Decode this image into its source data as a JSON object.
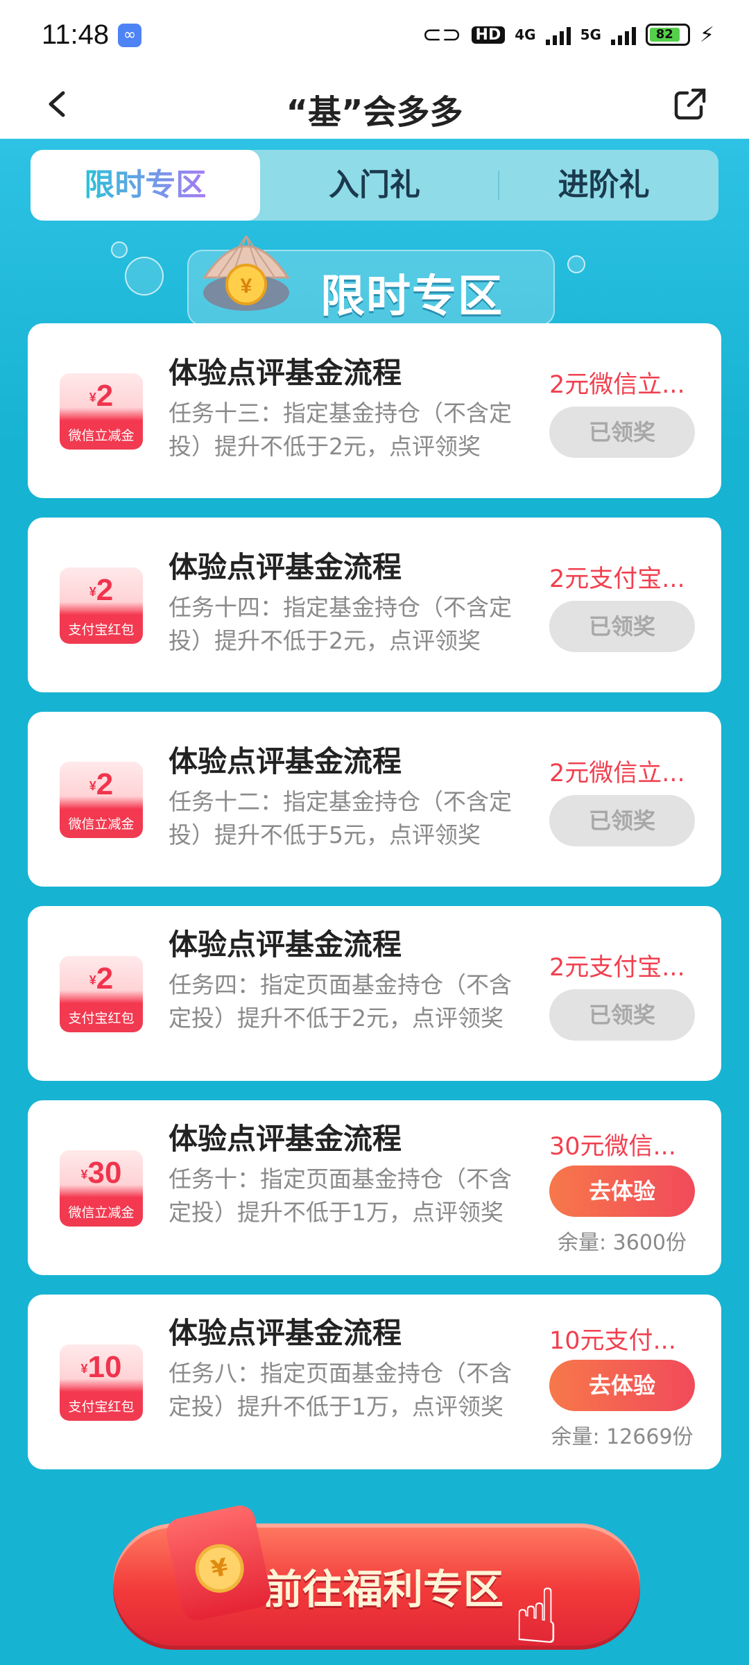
{
  "status_bar": {
    "time": "11:48",
    "network1": "4G",
    "network2": "5G",
    "hd_label": "HD",
    "battery": "82"
  },
  "nav": {
    "title": "“基”会多多"
  },
  "tabs": [
    {
      "label": "限时专区",
      "active": true
    },
    {
      "label": "入门礼",
      "active": false
    },
    {
      "label": "进阶礼",
      "active": false
    }
  ],
  "banner": {
    "title": "限时专区"
  },
  "tasks": [
    {
      "coupon_amount": "2",
      "coupon_label": "微信立减金",
      "title": "体验点评基金流程",
      "desc": "任务十三：指定基金持仓（不含定投）提升不低于2元，点评领奖",
      "reward": "2元微信立...",
      "button": "已领奖",
      "claimed": true
    },
    {
      "coupon_amount": "2",
      "coupon_label": "支付宝红包",
      "title": "体验点评基金流程",
      "desc": "任务十四：指定基金持仓（不含定投）提升不低于2元，点评领奖",
      "reward": "2元支付宝...",
      "button": "已领奖",
      "claimed": true
    },
    {
      "coupon_amount": "2",
      "coupon_label": "微信立减金",
      "title": "体验点评基金流程",
      "desc": "任务十二：指定基金持仓（不含定投）提升不低于5元，点评领奖",
      "reward": "2元微信立...",
      "button": "已领奖",
      "claimed": true
    },
    {
      "coupon_amount": "2",
      "coupon_label": "支付宝红包",
      "title": "体验点评基金流程",
      "desc": "任务四：指定页面基金持仓（不含定投）提升不低于2元，点评领奖",
      "reward": "2元支付宝...",
      "button": "已领奖",
      "claimed": true
    },
    {
      "coupon_amount": "30",
      "coupon_label": "微信立减金",
      "title": "体验点评基金流程",
      "desc": "任务十：指定页面基金持仓（不含定投）提升不低于1万，点评领奖",
      "reward": "30元微信...",
      "button": "去体验",
      "claimed": false,
      "remaining": "余量: 3600份"
    },
    {
      "coupon_amount": "10",
      "coupon_label": "支付宝红包",
      "title": "体验点评基金流程",
      "desc": "任务八：指定页面基金持仓（不含定投）提升不低于1万，点评领奖",
      "reward": "10元支付...",
      "button": "去体验",
      "claimed": false,
      "remaining": "余量: 12669份"
    }
  ],
  "cta": {
    "label": "前往福利专区"
  },
  "colors": {
    "sea": "#17b3d2",
    "accent_red": "#f0404f",
    "tab_bar": "#8fdbe8"
  }
}
